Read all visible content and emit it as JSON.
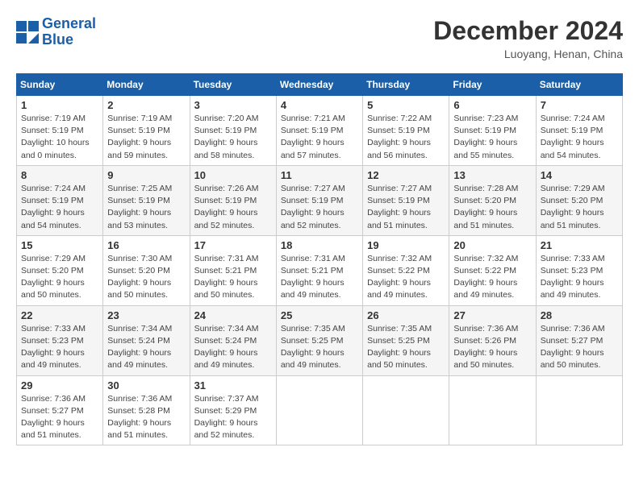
{
  "logo": {
    "line1": "General",
    "line2": "Blue"
  },
  "title": "December 2024",
  "location": "Luoyang, Henan, China",
  "weekdays": [
    "Sunday",
    "Monday",
    "Tuesday",
    "Wednesday",
    "Thursday",
    "Friday",
    "Saturday"
  ],
  "weeks": [
    [
      {
        "day": "1",
        "info": "Sunrise: 7:19 AM\nSunset: 5:19 PM\nDaylight: 10 hours\nand 0 minutes."
      },
      {
        "day": "2",
        "info": "Sunrise: 7:19 AM\nSunset: 5:19 PM\nDaylight: 9 hours\nand 59 minutes."
      },
      {
        "day": "3",
        "info": "Sunrise: 7:20 AM\nSunset: 5:19 PM\nDaylight: 9 hours\nand 58 minutes."
      },
      {
        "day": "4",
        "info": "Sunrise: 7:21 AM\nSunset: 5:19 PM\nDaylight: 9 hours\nand 57 minutes."
      },
      {
        "day": "5",
        "info": "Sunrise: 7:22 AM\nSunset: 5:19 PM\nDaylight: 9 hours\nand 56 minutes."
      },
      {
        "day": "6",
        "info": "Sunrise: 7:23 AM\nSunset: 5:19 PM\nDaylight: 9 hours\nand 55 minutes."
      },
      {
        "day": "7",
        "info": "Sunrise: 7:24 AM\nSunset: 5:19 PM\nDaylight: 9 hours\nand 54 minutes."
      }
    ],
    [
      {
        "day": "8",
        "info": "Sunrise: 7:24 AM\nSunset: 5:19 PM\nDaylight: 9 hours\nand 54 minutes."
      },
      {
        "day": "9",
        "info": "Sunrise: 7:25 AM\nSunset: 5:19 PM\nDaylight: 9 hours\nand 53 minutes."
      },
      {
        "day": "10",
        "info": "Sunrise: 7:26 AM\nSunset: 5:19 PM\nDaylight: 9 hours\nand 52 minutes."
      },
      {
        "day": "11",
        "info": "Sunrise: 7:27 AM\nSunset: 5:19 PM\nDaylight: 9 hours\nand 52 minutes."
      },
      {
        "day": "12",
        "info": "Sunrise: 7:27 AM\nSunset: 5:19 PM\nDaylight: 9 hours\nand 51 minutes."
      },
      {
        "day": "13",
        "info": "Sunrise: 7:28 AM\nSunset: 5:20 PM\nDaylight: 9 hours\nand 51 minutes."
      },
      {
        "day": "14",
        "info": "Sunrise: 7:29 AM\nSunset: 5:20 PM\nDaylight: 9 hours\nand 51 minutes."
      }
    ],
    [
      {
        "day": "15",
        "info": "Sunrise: 7:29 AM\nSunset: 5:20 PM\nDaylight: 9 hours\nand 50 minutes."
      },
      {
        "day": "16",
        "info": "Sunrise: 7:30 AM\nSunset: 5:20 PM\nDaylight: 9 hours\nand 50 minutes."
      },
      {
        "day": "17",
        "info": "Sunrise: 7:31 AM\nSunset: 5:21 PM\nDaylight: 9 hours\nand 50 minutes."
      },
      {
        "day": "18",
        "info": "Sunrise: 7:31 AM\nSunset: 5:21 PM\nDaylight: 9 hours\nand 49 minutes."
      },
      {
        "day": "19",
        "info": "Sunrise: 7:32 AM\nSunset: 5:22 PM\nDaylight: 9 hours\nand 49 minutes."
      },
      {
        "day": "20",
        "info": "Sunrise: 7:32 AM\nSunset: 5:22 PM\nDaylight: 9 hours\nand 49 minutes."
      },
      {
        "day": "21",
        "info": "Sunrise: 7:33 AM\nSunset: 5:23 PM\nDaylight: 9 hours\nand 49 minutes."
      }
    ],
    [
      {
        "day": "22",
        "info": "Sunrise: 7:33 AM\nSunset: 5:23 PM\nDaylight: 9 hours\nand 49 minutes."
      },
      {
        "day": "23",
        "info": "Sunrise: 7:34 AM\nSunset: 5:24 PM\nDaylight: 9 hours\nand 49 minutes."
      },
      {
        "day": "24",
        "info": "Sunrise: 7:34 AM\nSunset: 5:24 PM\nDaylight: 9 hours\nand 49 minutes."
      },
      {
        "day": "25",
        "info": "Sunrise: 7:35 AM\nSunset: 5:25 PM\nDaylight: 9 hours\nand 49 minutes."
      },
      {
        "day": "26",
        "info": "Sunrise: 7:35 AM\nSunset: 5:25 PM\nDaylight: 9 hours\nand 50 minutes."
      },
      {
        "day": "27",
        "info": "Sunrise: 7:36 AM\nSunset: 5:26 PM\nDaylight: 9 hours\nand 50 minutes."
      },
      {
        "day": "28",
        "info": "Sunrise: 7:36 AM\nSunset: 5:27 PM\nDaylight: 9 hours\nand 50 minutes."
      }
    ],
    [
      {
        "day": "29",
        "info": "Sunrise: 7:36 AM\nSunset: 5:27 PM\nDaylight: 9 hours\nand 51 minutes."
      },
      {
        "day": "30",
        "info": "Sunrise: 7:36 AM\nSunset: 5:28 PM\nDaylight: 9 hours\nand 51 minutes."
      },
      {
        "day": "31",
        "info": "Sunrise: 7:37 AM\nSunset: 5:29 PM\nDaylight: 9 hours\nand 52 minutes."
      },
      null,
      null,
      null,
      null
    ]
  ]
}
